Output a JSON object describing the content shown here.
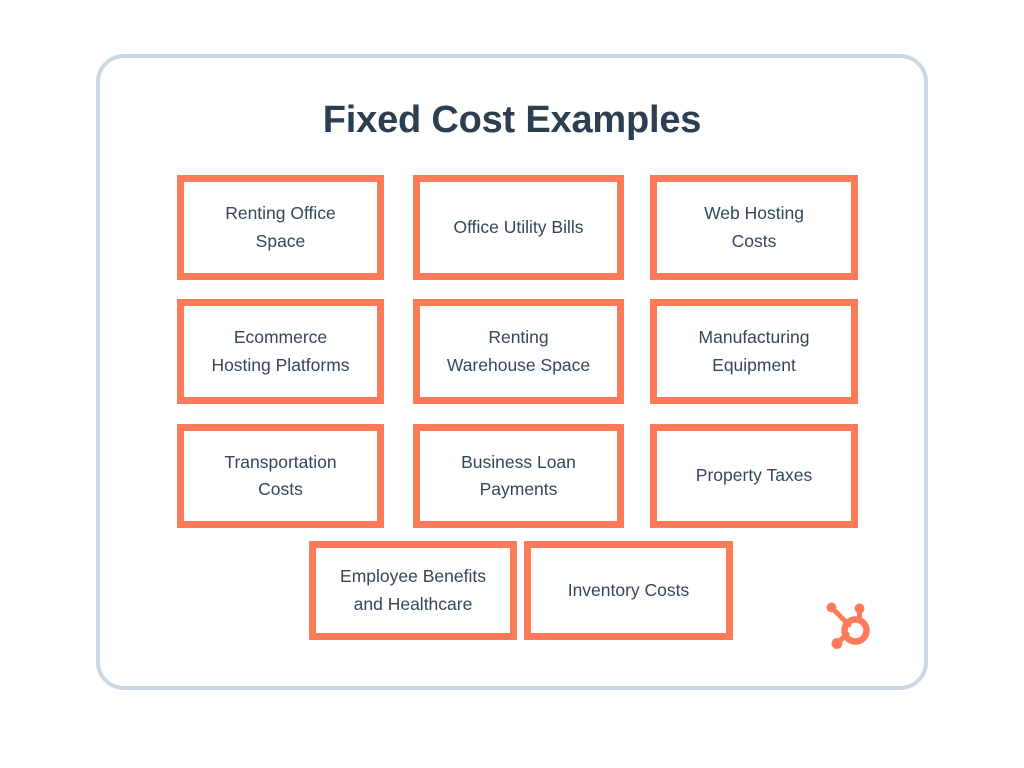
{
  "card": {
    "title": "Fixed Cost Examples",
    "border_color": "#cdd7e3",
    "background": "#ffffff"
  },
  "theme": {
    "accent_orange": "#ff7a59",
    "title_color": "#2d3e50",
    "item_text_color": "#33475b",
    "page_background": "#ffffff"
  },
  "logo": {
    "name": "hubspot-sprocket-logo",
    "color": "#ff7a59"
  },
  "chart_data": {
    "type": "table",
    "title": "Fixed Cost Examples",
    "xlabel": "",
    "ylabel": "",
    "layout": "grid of labelled boxes, 3 columns x 3 rows plus a centered final row of 2",
    "categories": [
      "Renting Office Space",
      "Office Utility Bills",
      "Web Hosting Costs",
      "Ecommerce Hosting Platforms",
      "Renting Warehouse Space",
      "Manufacturing Equipment",
      "Transportation Costs",
      "Business Loan Payments",
      "Property Taxes",
      "Employee Benefits and Healthcare",
      "Inventory Costs"
    ],
    "values": [
      1,
      1,
      1,
      1,
      1,
      1,
      1,
      1,
      1,
      1,
      1
    ]
  },
  "grid": {
    "rows": [
      {
        "cells": [
          {
            "text": "Renting Office\nSpace",
            "name": "cost-item-renting-office-space"
          },
          {
            "text": "Office Utility Bills",
            "name": "cost-item-office-utility-bills"
          },
          {
            "text": "Web Hosting\nCosts",
            "name": "cost-item-web-hosting-costs"
          }
        ]
      },
      {
        "cells": [
          {
            "text": "Ecommerce\nHosting Platforms",
            "name": "cost-item-ecommerce-hosting-platforms"
          },
          {
            "text": "Renting\nWarehouse Space",
            "name": "cost-item-renting-warehouse-space"
          },
          {
            "text": "Manufacturing\nEquipment",
            "name": "cost-item-manufacturing-equipment"
          }
        ]
      },
      {
        "cells": [
          {
            "text": "Transportation\nCosts",
            "name": "cost-item-transportation-costs"
          },
          {
            "text": "Business Loan\nPayments",
            "name": "cost-item-business-loan-payments"
          },
          {
            "text": "Property Taxes",
            "name": "cost-item-property-taxes"
          }
        ]
      },
      {
        "cells": [
          {
            "text": "Employee Benefits\nand Healthcare",
            "name": "cost-item-employee-benefits-and-healthcare"
          },
          {
            "text": "Inventory Costs",
            "name": "cost-item-inventory-costs"
          }
        ]
      }
    ]
  }
}
